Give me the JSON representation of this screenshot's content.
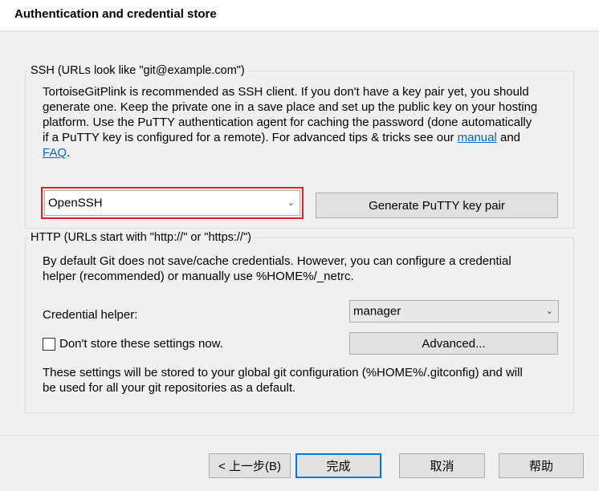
{
  "header": {
    "title": "Authentication and credential store"
  },
  "ssh": {
    "group_label": "SSH (URLs look like \"git@example.com\")",
    "lines": [
      "TortoiseGitPlink is recommended as SSH client. If you don't have a key pair yet, you should",
      "generate one. Keep the private one in a save place and set up the public key on your hosting",
      "platform. Use the PuTTY authentication agent for caching the password (done automatically",
      "if a PuTTY key is configured for a remote). For advanced tips & tricks see our "
    ],
    "link_manual": "manual",
    "and_text": " and",
    "link_faq": "FAQ",
    "faq_suffix": ".",
    "client_value": "OpenSSH",
    "generate_button": "Generate PuTTY  key pair"
  },
  "http": {
    "group_label": "HTTP (URLs start with \"http://\" or \"https://\")",
    "lines": [
      "By default Git does not save/cache credentials. However, you can configure a credential",
      "helper (recommended) or manually use %HOME%/_netrc."
    ],
    "credential_helper_label": "Credential helper:",
    "credential_helper_value": "manager",
    "dont_store_label": "Don't store these settings now.",
    "advanced_button": "Advanced...",
    "note_lines": [
      "These settings will be stored to your global git configuration (%HOME%/.gitconfig) and will",
      "be used for all your git repositories as a default."
    ]
  },
  "footer": {
    "back_button": "< 上一步(B)",
    "finish_button": "完成",
    "cancel_button": "取消",
    "help_button": "帮助"
  },
  "colors": {
    "accent": "#0078d7",
    "highlight_ring": "#e0232b",
    "link": "#0066cc"
  }
}
